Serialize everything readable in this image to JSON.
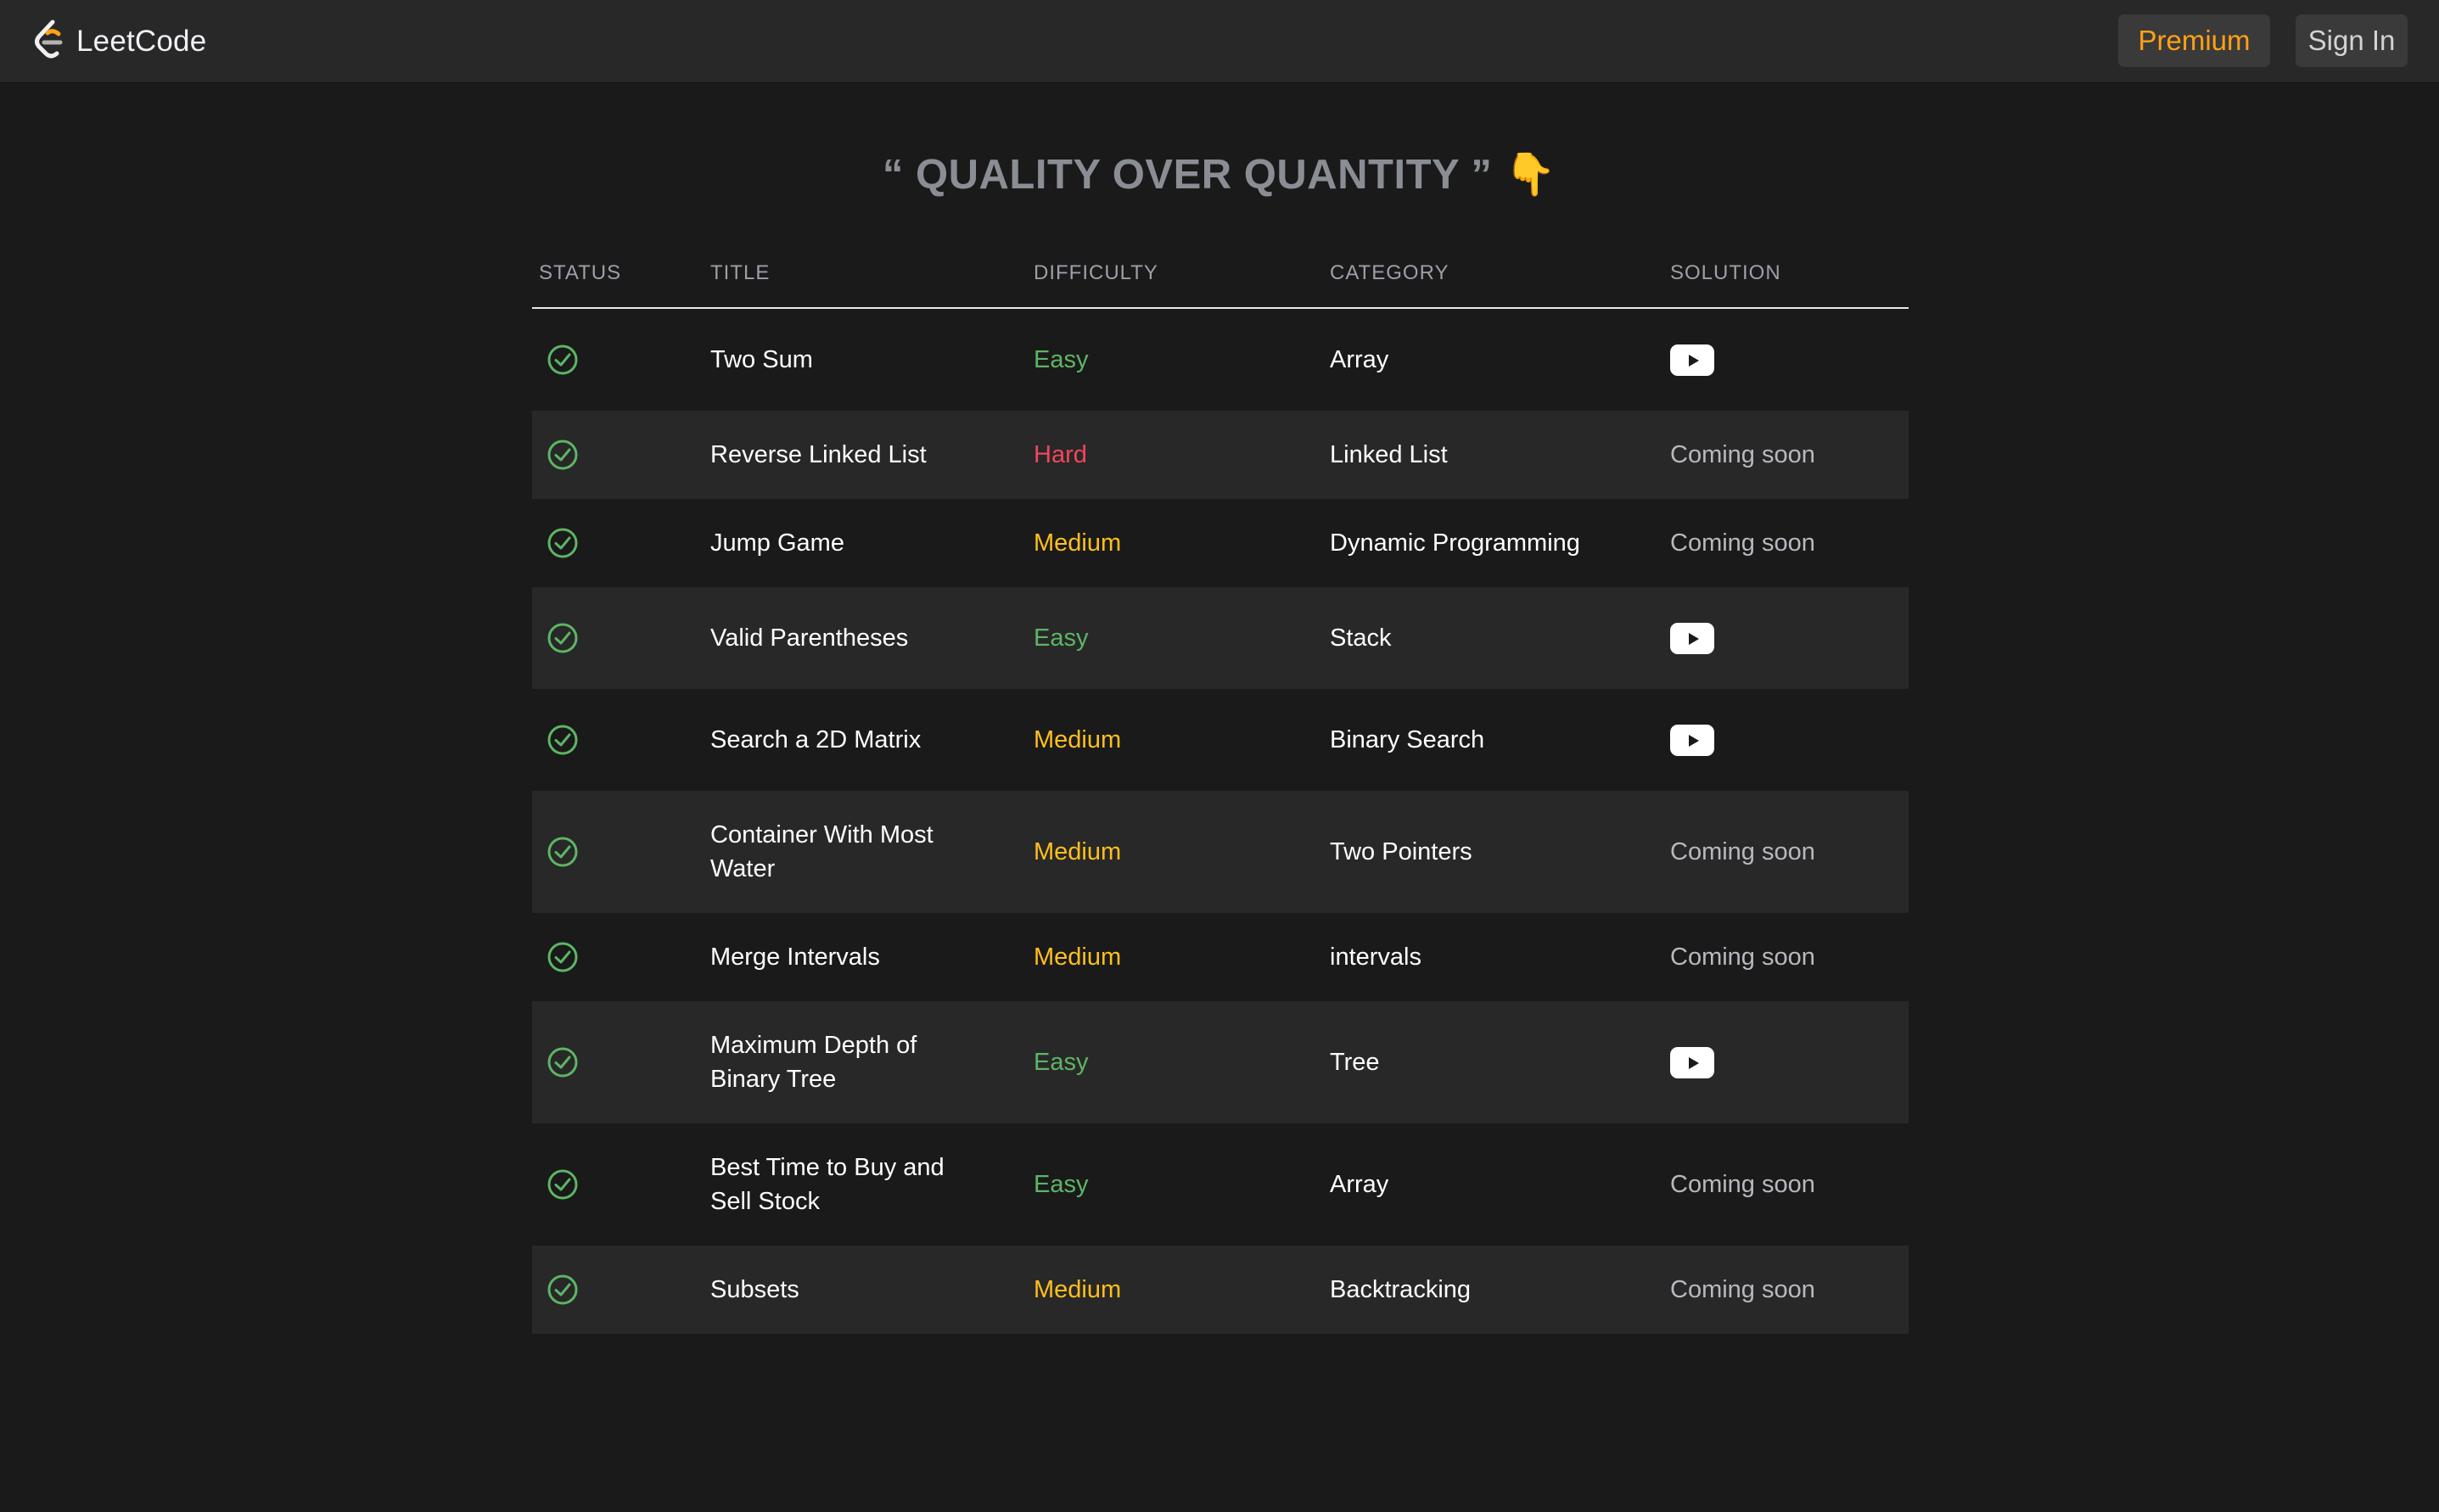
{
  "nav": {
    "brand": "LeetCode",
    "premium_label": "Premium",
    "signin_label": "Sign In"
  },
  "quote": {
    "text": "“ QUALITY OVER QUANTITY ”",
    "emoji": "👇"
  },
  "table": {
    "headers": {
      "status": "STATUS",
      "title": "TITLE",
      "difficulty": "DIFFICULTY",
      "category": "CATEGORY",
      "solution": "SOLUTION"
    },
    "rows": [
      {
        "status": "check-circle-icon",
        "title": "Two Sum",
        "difficulty": "Easy",
        "category": "Array",
        "solution": "video",
        "solution_text": ""
      },
      {
        "status": "check-circle-icon",
        "title": "Reverse Linked List",
        "difficulty": "Hard",
        "category": "Linked List",
        "solution": "text",
        "solution_text": "Coming soon"
      },
      {
        "status": "check-circle-icon",
        "title": "Jump Game",
        "difficulty": "Medium",
        "category": "Dynamic Programming",
        "solution": "text",
        "solution_text": "Coming soon"
      },
      {
        "status": "check-circle-icon",
        "title": "Valid Parentheses",
        "difficulty": "Easy",
        "category": "Stack",
        "solution": "video",
        "solution_text": ""
      },
      {
        "status": "check-circle-icon",
        "title": "Search a 2D Matrix",
        "difficulty": "Medium",
        "category": "Binary Search",
        "solution": "video",
        "solution_text": ""
      },
      {
        "status": "check-circle-icon",
        "title": "Container With Most Water",
        "difficulty": "Medium",
        "category": "Two Pointers",
        "solution": "text",
        "solution_text": "Coming soon"
      },
      {
        "status": "check-circle-icon",
        "title": "Merge Intervals",
        "difficulty": "Medium",
        "category": "intervals",
        "solution": "text",
        "solution_text": "Coming soon"
      },
      {
        "status": "check-circle-icon",
        "title": "Maximum Depth of Binary Tree",
        "difficulty": "Easy",
        "category": "Tree",
        "solution": "video",
        "solution_text": ""
      },
      {
        "status": "check-circle-icon",
        "title": "Best Time to Buy and Sell Stock",
        "difficulty": "Easy",
        "category": "Array",
        "solution": "text",
        "solution_text": "Coming soon"
      },
      {
        "status": "check-circle-icon",
        "title": "Subsets",
        "difficulty": "Medium",
        "category": "Backtracking",
        "solution": "text",
        "solution_text": "Coming soon"
      }
    ]
  },
  "colors": {
    "background": "#1a1a1a",
    "navbar": "#282828",
    "row_alt": "#282828",
    "easy": "#5db565",
    "medium": "#ffc01e",
    "hard": "#f0475b",
    "premium": "#ffa116"
  }
}
